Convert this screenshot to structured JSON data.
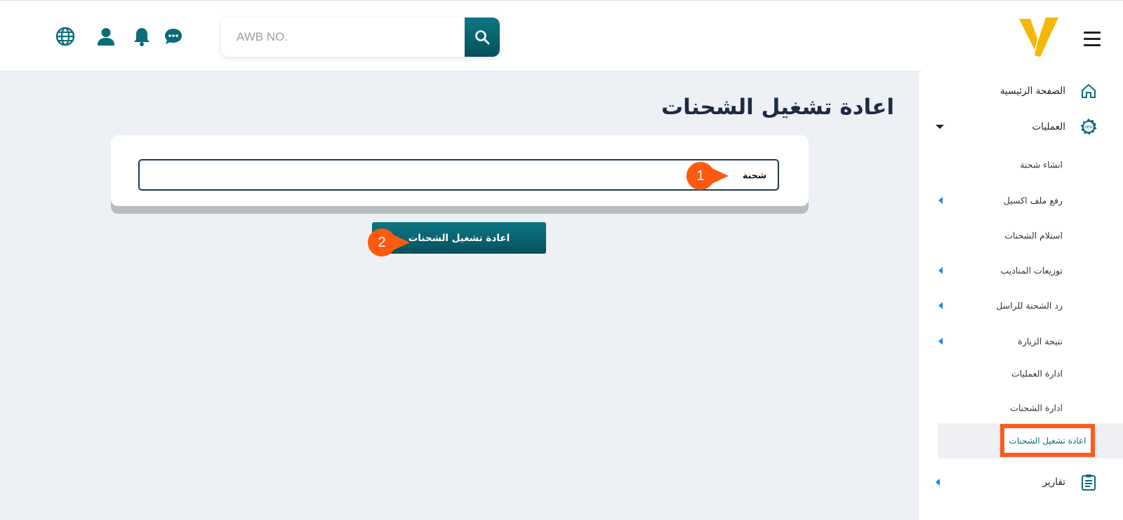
{
  "header": {
    "search_placeholder": "AWB NO.",
    "icons": [
      "globe-icon",
      "user-icon",
      "bell-icon",
      "chat-icon"
    ]
  },
  "sidebar": {
    "home": "الصفحة الرئيسية",
    "operations": "العمليات",
    "new_badge": "NEW",
    "sub_items": [
      {
        "label": "انشاء شحنة"
      },
      {
        "label": "رفع ملف اكسيل"
      },
      {
        "label": "استلام الشحنات"
      },
      {
        "label": "توزيعات المناديب"
      },
      {
        "label": "رد الشحنة للراسل"
      },
      {
        "label": "نتيجة الزيارة"
      },
      {
        "label": "ادارة العمليات"
      },
      {
        "label": "ادارة الشحنات"
      },
      {
        "label": "اعادة تشغيل الشحنات"
      }
    ],
    "reports": "تقارير"
  },
  "main": {
    "title": "اعادة تشغيل الشحنات",
    "field_label": "شحنة",
    "field_value": "",
    "submit_label": "اعادة تشغيل الشحنات"
  },
  "steps": [
    "1",
    "2"
  ],
  "colors": {
    "primary": "#0c6b78",
    "accent": "#fd5a0f",
    "logo": "#f5b800",
    "link_caret": "#1e88e5"
  }
}
